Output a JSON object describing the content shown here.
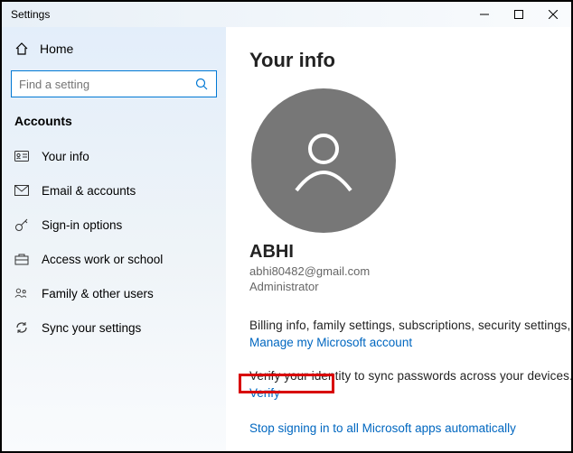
{
  "window": {
    "title": "Settings"
  },
  "sidebar": {
    "home": "Home",
    "search_placeholder": "Find a setting",
    "category": "Accounts",
    "items": [
      {
        "label": "Your info"
      },
      {
        "label": "Email & accounts"
      },
      {
        "label": "Sign-in options"
      },
      {
        "label": "Access work or school"
      },
      {
        "label": "Family & other users"
      },
      {
        "label": "Sync your settings"
      }
    ]
  },
  "main": {
    "title": "Your info",
    "user_name": "ABHI",
    "user_email": "abhi80482@gmail.com",
    "user_role": "Administrator",
    "billing_desc": "Billing info, family settings, subscriptions, security settings, and more",
    "manage_link": "Manage my Microsoft account",
    "verify_desc": "Verify your identity to sync passwords across your devices.",
    "verify_link": "Verify",
    "stop_link": "Stop signing in to all Microsoft apps automatically"
  }
}
